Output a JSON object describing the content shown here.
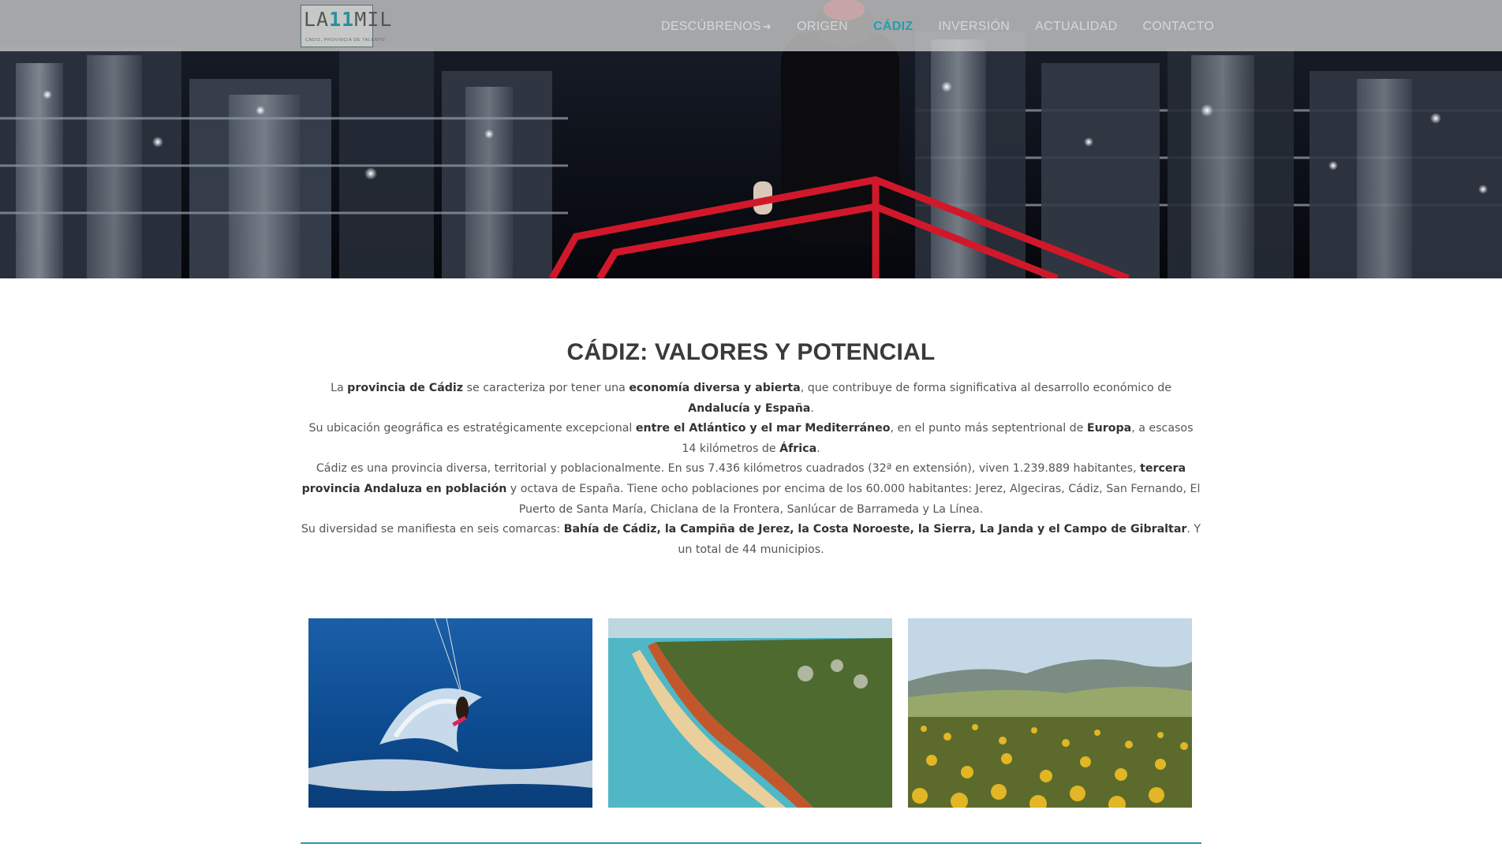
{
  "logo": {
    "prefix": "LA",
    "number": "11",
    "suffix": "MIL",
    "tagline": "CÁDIZ, PROVINCIA DE TALENTO"
  },
  "nav": {
    "items": [
      {
        "label": "DESCÚBRENOS",
        "suffix": "➔"
      },
      {
        "label": "ORIGEN",
        "suffix": ""
      },
      {
        "label": "CÁDIZ",
        "suffix": ""
      },
      {
        "label": "INVERSIÓN",
        "suffix": ""
      },
      {
        "label": "ACTUALIDAD",
        "suffix": ""
      },
      {
        "label": "CONTACTO",
        "suffix": ""
      }
    ],
    "active": "CÁDIZ"
  },
  "section": {
    "title": "CÁDIZ: VALORES Y POTENCIAL",
    "p1": {
      "t1": "La ",
      "b1": "provincia de Cádiz",
      "t2": " se caracteriza por tener una ",
      "b2": "economía diversa y abierta",
      "t3": ", que contribuye de forma significativa al desarrollo económico de ",
      "b3": "Andalucía y España",
      "t4": "."
    },
    "p2": {
      "t1": "Su ubicación geográfica es estratégicamente excepcional ",
      "b1": "entre el Atlántico y el mar Mediterráneo",
      "t2": ", en el punto más septentrional de ",
      "b2": "Europa",
      "t3": ", a escasos 14 kilómetros de ",
      "b3": "África",
      "t4": "."
    },
    "p3": {
      "t1": "Cádiz es una provincia diversa, territorial y poblacionalmente. En sus 7.436 kilómetros cuadrados (32ª en extensión), viven 1.239.889 habitantes, ",
      "b1": "tercera provincia Andaluza en población",
      "t2": " y octava de España. Tiene ocho poblaciones por encima de los 60.000 habitantes: Jerez, Algeciras, Cádiz, San Fernando, El Puerto de Santa María, Chiclana de la Frontera, Sanlúcar de Barrameda y La Línea."
    },
    "p4": {
      "t1": "Su diversidad se manifiesta en seis comarcas: ",
      "b1": "Bahía de Cádiz, la Campiña de Jerez, la Costa Noroeste, la Sierra, La Janda y el Campo de Gibraltar",
      "t2": ". Y un total de 44 municipios."
    }
  },
  "gallery": [
    {
      "subject": "kitesurf-photo"
    },
    {
      "subject": "coastline-cliffs-photo"
    },
    {
      "subject": "sunflower-field-photo"
    }
  ],
  "colors": {
    "accent": "#1da0b0",
    "rule": "#2a98a8"
  }
}
